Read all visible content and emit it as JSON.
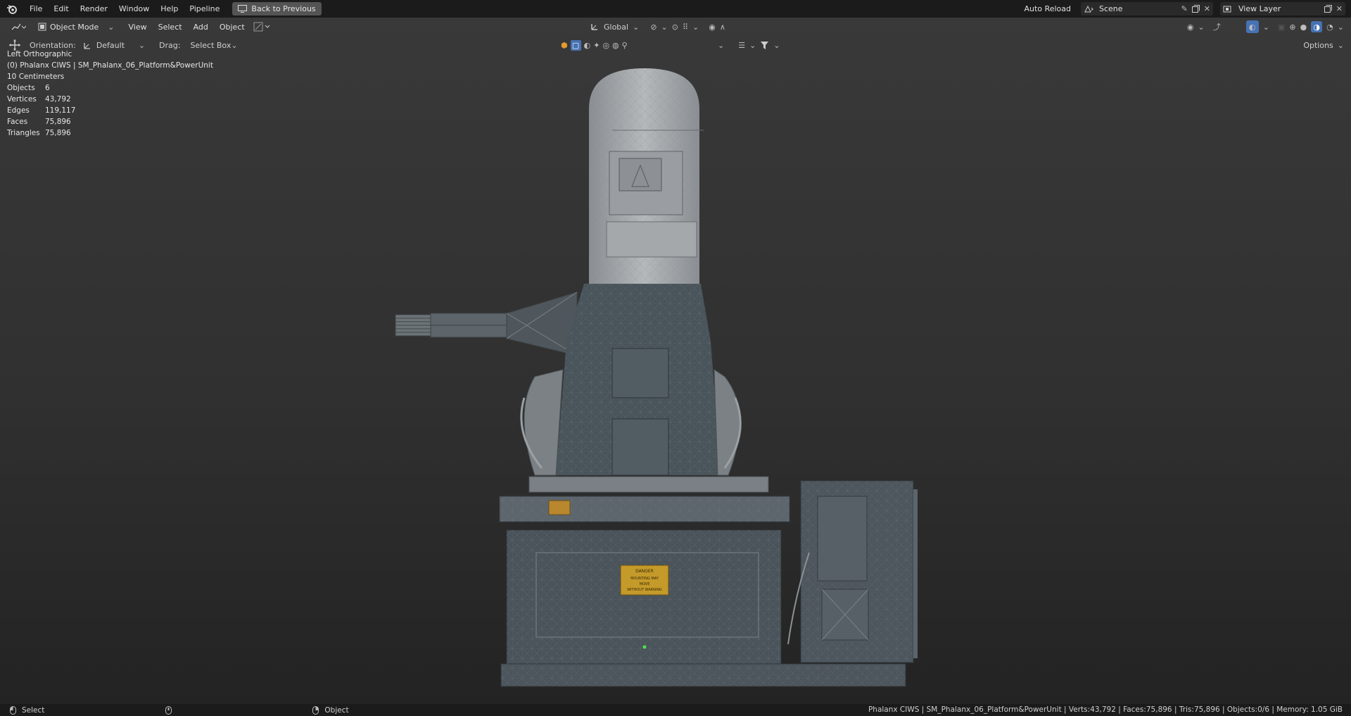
{
  "menus": [
    "File",
    "Edit",
    "Render",
    "Window",
    "Help",
    "Pipeline"
  ],
  "back_button": "Back to Previous",
  "auto_reload": "Auto Reload",
  "scene_name": "Scene",
  "view_layer": "View Layer",
  "header": {
    "mode": "Object Mode",
    "view": "View",
    "select": "Select",
    "add": "Add",
    "object": "Object",
    "transform_orientation": "Global",
    "orientation_label": "Orientation:",
    "orientation_value": "Default",
    "drag_label": "Drag:",
    "drag_value": "Select Box",
    "options": "Options"
  },
  "overlay": {
    "view_name": "Left Orthographic",
    "object_path": "(0) Phalanx CIWS | SM_Phalanx_06_Platform&PowerUnit",
    "grid_scale": "10 Centimeters"
  },
  "stats": [
    {
      "label": "Objects",
      "value": "6"
    },
    {
      "label": "Vertices",
      "value": "43,792"
    },
    {
      "label": "Edges",
      "value": "119,117"
    },
    {
      "label": "Faces",
      "value": "75,896"
    },
    {
      "label": "Triangles",
      "value": "75,896"
    }
  ],
  "model": {
    "placard_top": "DANGER",
    "placard_lines": [
      "MOUNTING MAY",
      "MOVE",
      "WITHOUT WARNING"
    ]
  },
  "statusbar": {
    "left_action": "Select",
    "mid_action": "Object",
    "info": "Phalanx CIWS | SM_Phalanx_06_Platform&PowerUnit | Verts:43,792 | Faces:75,896 | Tris:75,896 | Objects:0/6 | Memory: 1.05 GiB"
  },
  "colors": {
    "accent": "#4772b3",
    "top_bar": "#1b1b1b",
    "viewport_top": "#393939",
    "viewport_bottom": "#232323"
  }
}
